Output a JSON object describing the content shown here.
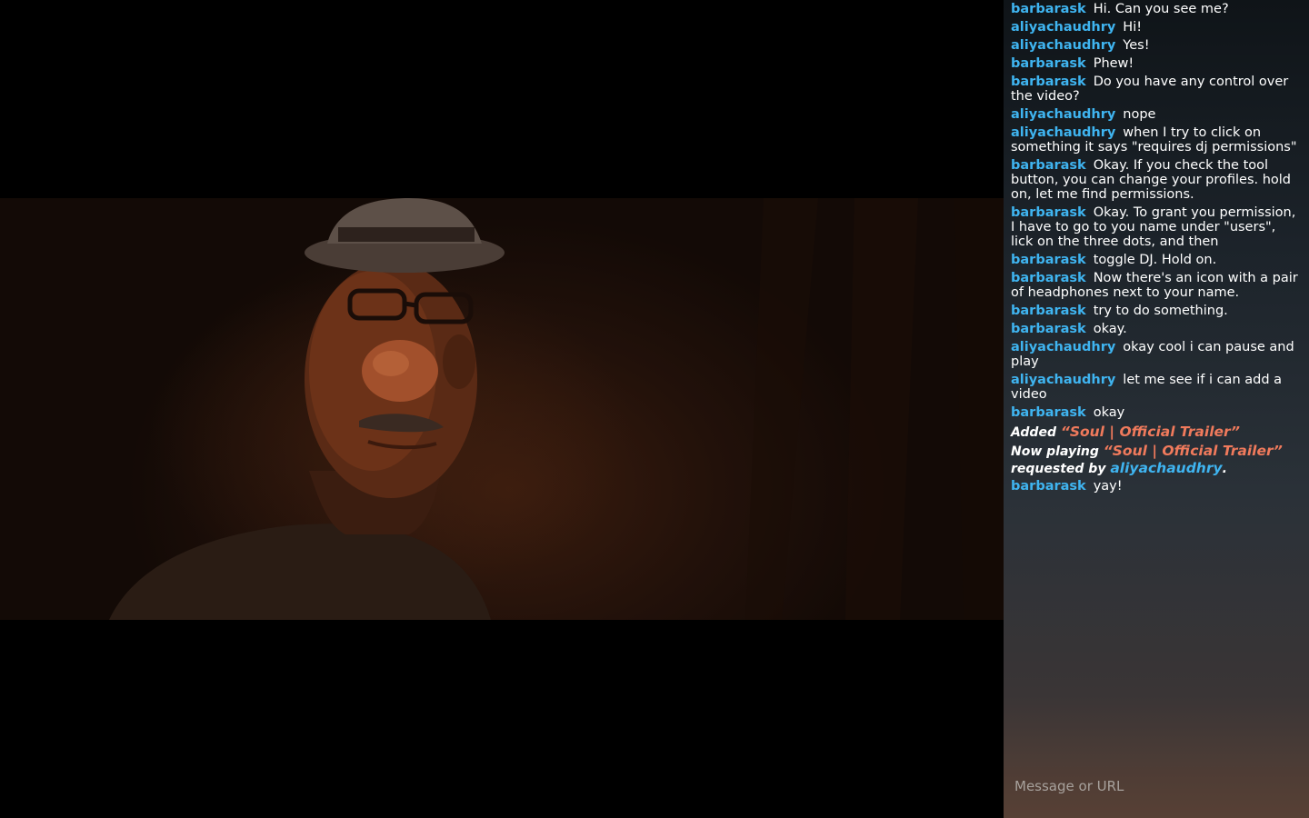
{
  "chat": {
    "messages": [
      {
        "user": "barbarask",
        "text": "Hi. Can you see me?"
      },
      {
        "user": "aliyachaudhry",
        "text": "Hi!"
      },
      {
        "user": "aliyachaudhry",
        "text": "Yes!"
      },
      {
        "user": "barbarask",
        "text": "Phew!"
      },
      {
        "user": "barbarask",
        "text": "Do you have any control over the video?"
      },
      {
        "user": "aliyachaudhry",
        "text": "nope"
      },
      {
        "user": "aliyachaudhry",
        "text": "when I try to click on something it says \"requires dj permissions\""
      },
      {
        "user": "barbarask",
        "text": "Okay. If you check the tool button, you can change your profiles. hold on, let me find permissions."
      },
      {
        "user": "barbarask",
        "text": "Okay. To grant you permission, I have to go to you name under \"users\", lick on the three dots, and then"
      },
      {
        "user": "barbarask",
        "text": "toggle DJ. Hold on."
      },
      {
        "user": "barbarask",
        "text": "Now there's an icon with a pair of headphones next to your name."
      },
      {
        "user": "barbarask",
        "text": "try to do something."
      },
      {
        "user": "barbarask",
        "text": "okay."
      },
      {
        "user": "aliyachaudhry",
        "text": "okay cool i can pause and play"
      },
      {
        "user": "aliyachaudhry",
        "text": "let me see if i can add a video"
      },
      {
        "user": "barbarask",
        "text": "okay"
      }
    ],
    "added": {
      "prefix": "Added",
      "title": "“Soul | Official Trailer”"
    },
    "now_playing": {
      "prefix": "Now playing",
      "title": "“Soul | Official Trailer”",
      "requested_by_label": "requested by",
      "requested_by_user": "aliyachaudhry",
      "suffix": "."
    },
    "after_messages": [
      {
        "user": "barbarask",
        "text": "yay!"
      }
    ],
    "input_placeholder": "Message or URL"
  },
  "colors": {
    "username": "#3fb4f0",
    "title": "#f07a5c",
    "message_text": "#ffffff"
  }
}
